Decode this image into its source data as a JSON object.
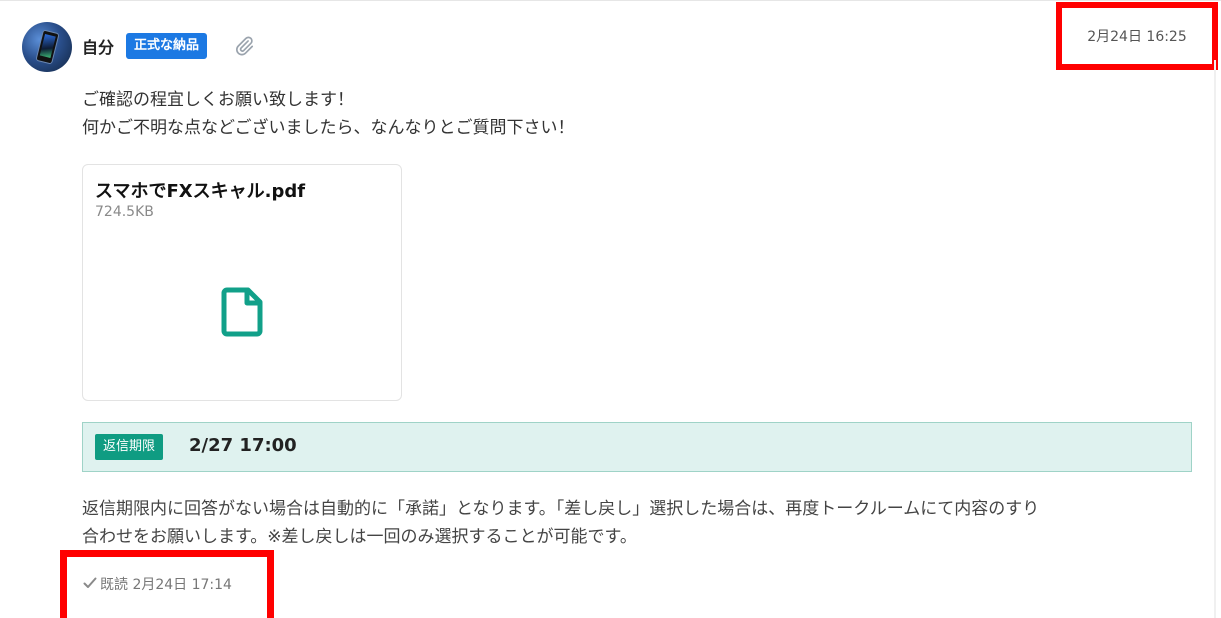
{
  "message": {
    "sender_name": "自分",
    "badge": "正式な納品",
    "sent_time": "2月24日 16:25",
    "body_lines": [
      "ご確認の程宜しくお願い致します！",
      "何かご不明な点などございましたら、なんなりとご質問下さい！"
    ],
    "attachment": {
      "file_name": "スマホでFXスキャル.pdf",
      "file_size": "724.5KB"
    },
    "reply_deadline": {
      "label": "返信期限",
      "value": "2/27 17:00"
    },
    "notice_lines": [
      "返信期限内に回答がない場合は自動的に「承諾」となります。「差し戻し」選択した場合は、再度トークルームにて内容のすり",
      "合わせをお願いします。※差し戻しは一回のみ選択することが可能です。"
    ],
    "read_status": "既読 2月24日 17:14"
  },
  "colors": {
    "badge": "#1c79e3",
    "deadline_label": "#0f9c82",
    "deadline_bg": "#dff2ef",
    "file_icon": "#11a089",
    "highlight": "#ff0000"
  },
  "icons": {
    "avatar": "avatar",
    "attachment": "paperclip-icon",
    "file": "document-icon",
    "read": "checkmark-icon"
  }
}
